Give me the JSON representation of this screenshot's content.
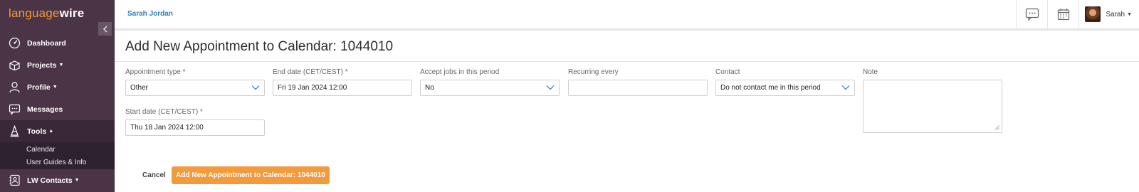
{
  "sidebar": {
    "logo_part1": "language",
    "logo_part2": "wire",
    "collapse_icon": "chevron-left-icon",
    "items": [
      {
        "label": "Dashboard",
        "icon": "speedometer-icon"
      },
      {
        "label": "Projects",
        "icon": "projects-icon",
        "has_caret": true
      },
      {
        "label": "Profile",
        "icon": "user-icon",
        "has_caret": true
      },
      {
        "label": "Messages",
        "icon": "chat-icon"
      },
      {
        "label": "Tools",
        "icon": "tools-icon",
        "has_caret": true,
        "expanded": true
      },
      {
        "label": "LW Contacts",
        "icon": "contacts-icon",
        "has_caret": true
      }
    ],
    "tools_sub": [
      {
        "label": "Calendar"
      },
      {
        "label": "User Guides & Info"
      }
    ]
  },
  "header": {
    "user_name": "Sarah Jordan",
    "short_name": "Sarah",
    "icons": [
      "chat-icon",
      "calendar-icon"
    ]
  },
  "page": {
    "title": "Add New Appointment to Calendar: 1044010"
  },
  "form": {
    "appointment_type": {
      "label": "Appointment type *",
      "value": "Other"
    },
    "start_date": {
      "label": "Start date (CET/CEST) *",
      "value": "Thu 18 Jan 2024 12:00"
    },
    "end_date": {
      "label": "End date (CET/CEST) *",
      "value": "Fri 19 Jan 2024 12:00"
    },
    "accept_jobs": {
      "label": "Accept jobs in this period",
      "value": "No"
    },
    "recurring": {
      "label": "Recurring every",
      "value": ""
    },
    "contact": {
      "label": "Contact",
      "value": "Do not contact me in this period"
    },
    "note": {
      "label": "Note",
      "value": ""
    }
  },
  "actions": {
    "cancel_label": "Cancel",
    "submit_label": "Add New Appointment to Calendar: 1044010"
  },
  "colors": {
    "sidebar_bg": "#4a3446",
    "accent_orange": "#f39a3c",
    "link_blue": "#2b7fb8"
  }
}
